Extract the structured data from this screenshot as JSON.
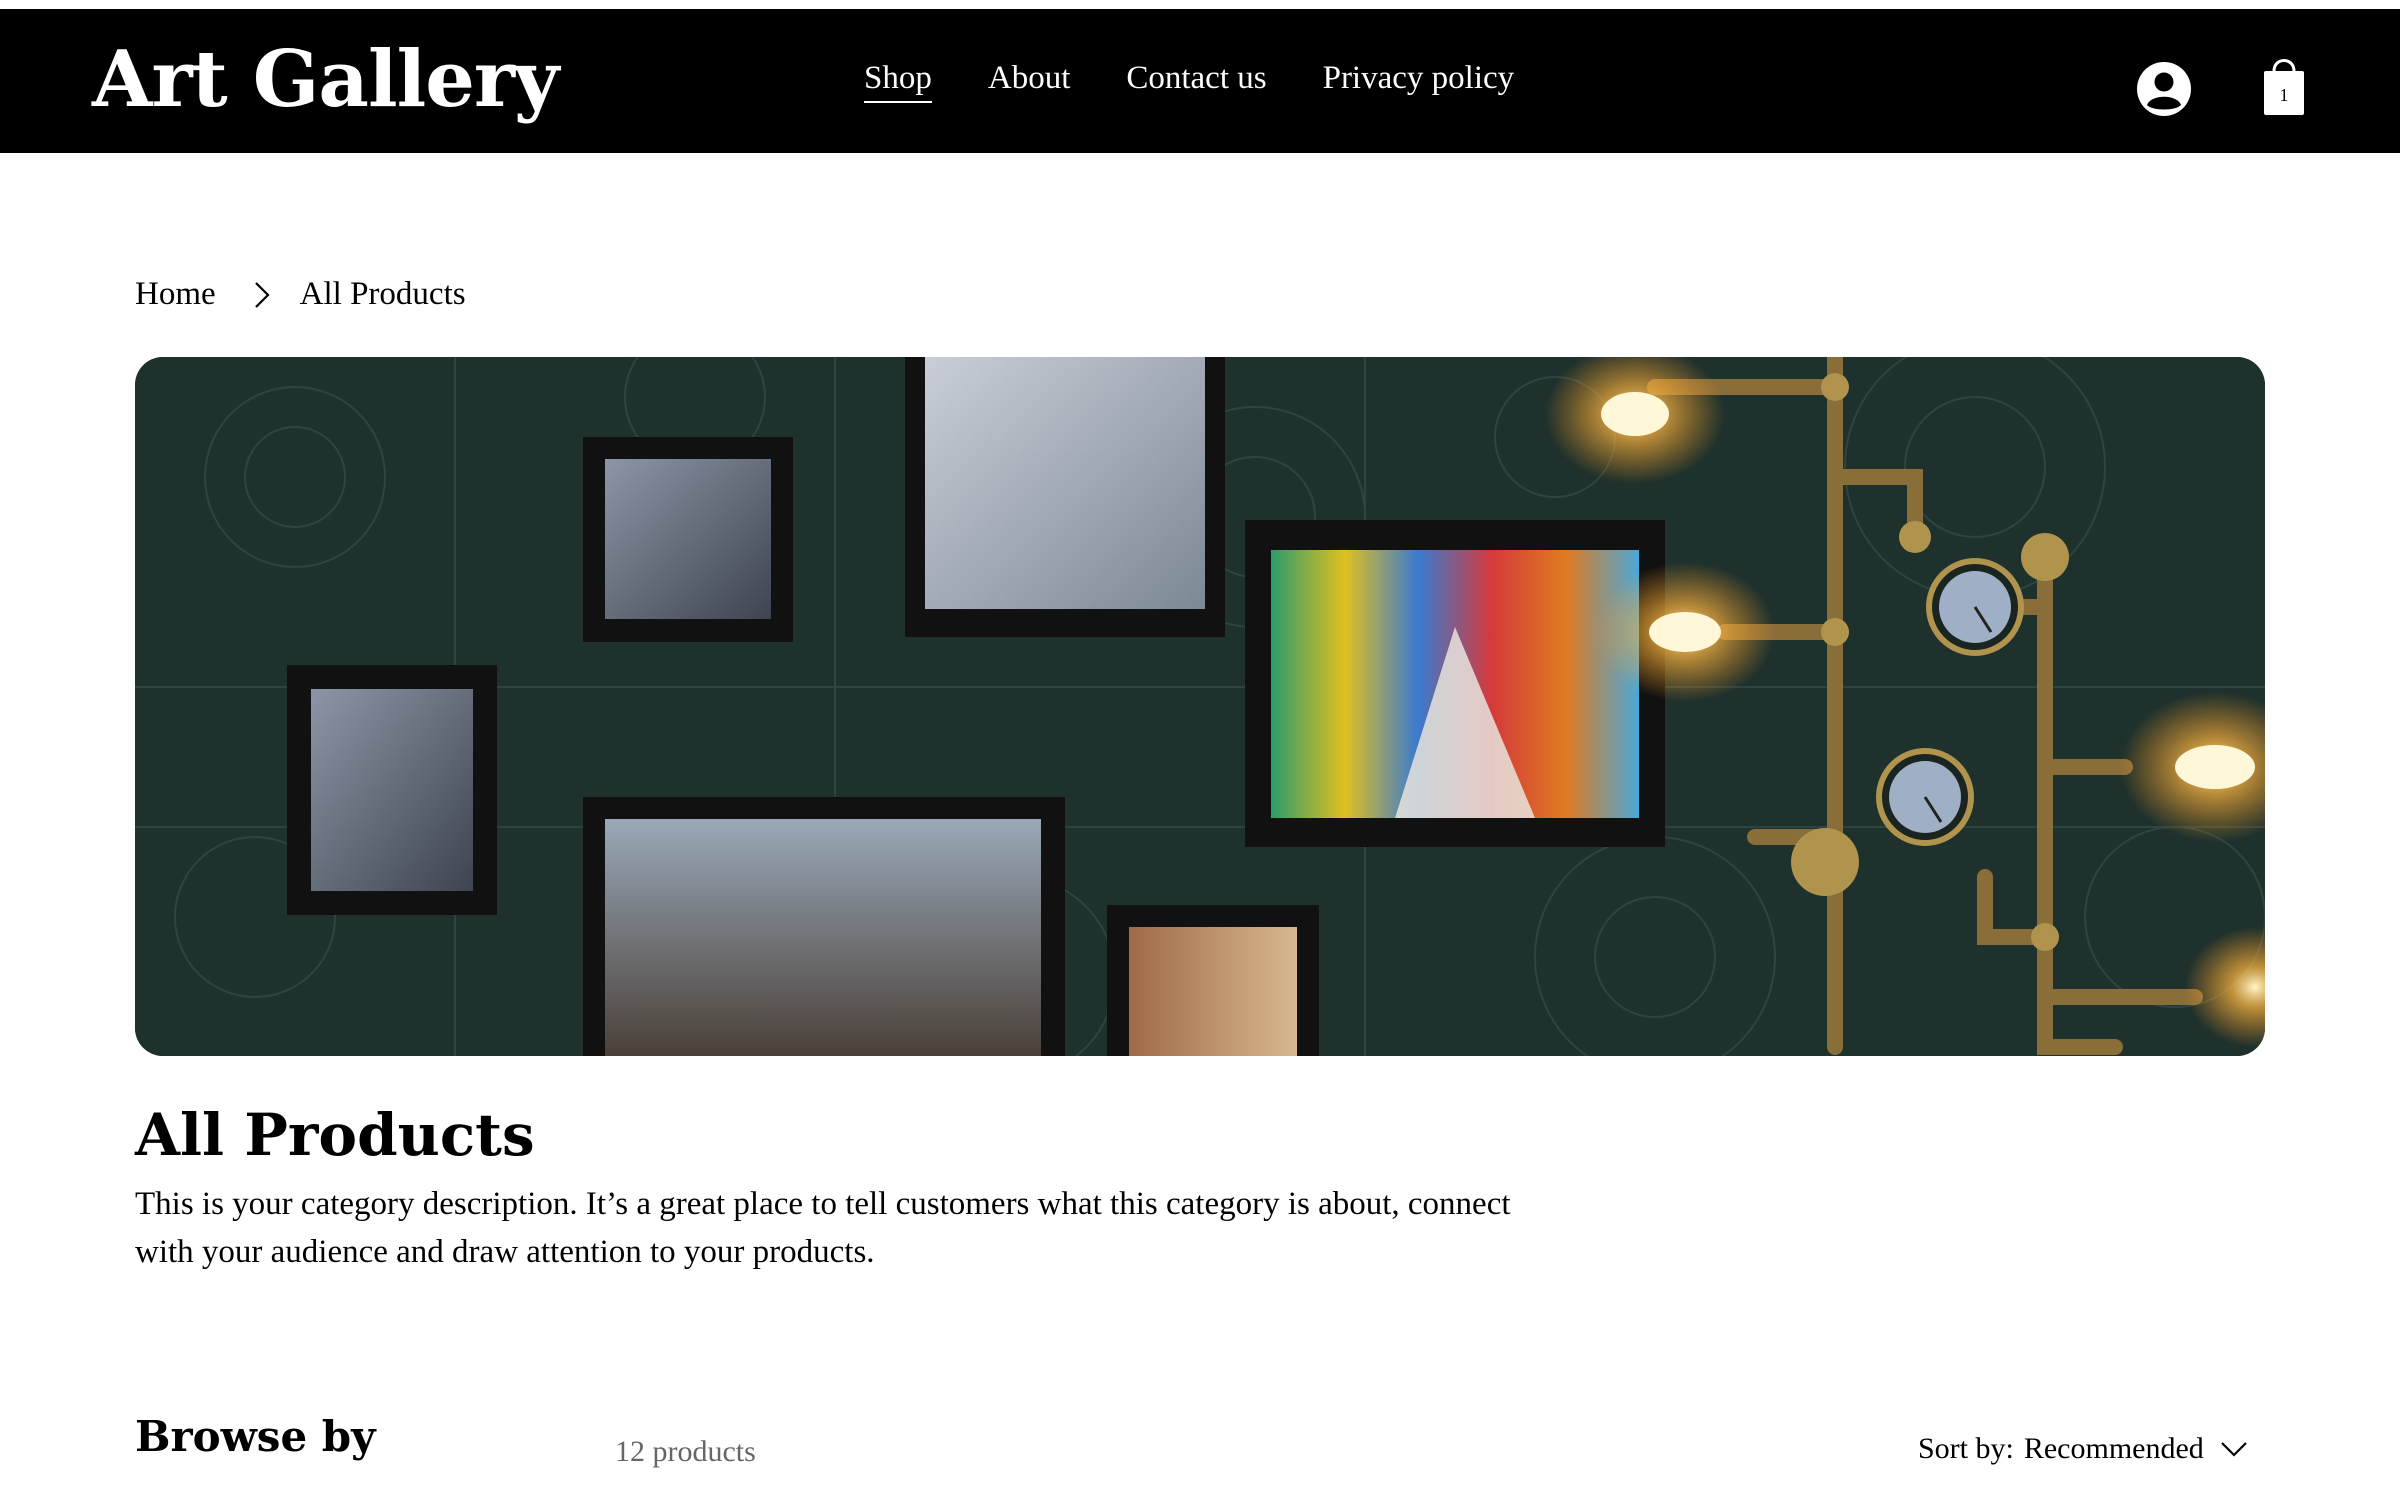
{
  "header": {
    "logo": "Art Gallery",
    "nav": [
      {
        "label": "Shop",
        "active": true
      },
      {
        "label": "About"
      },
      {
        "label": "Contact us"
      },
      {
        "label": "Privacy policy"
      }
    ],
    "user_icon": "user-circle-icon",
    "cart_icon": "shopping-bag-icon",
    "cart_count": "1"
  },
  "breadcrumb": {
    "home": "Home",
    "separator_icon": "chevron-right-icon",
    "current": "All Products"
  },
  "hero": {
    "description": "dark green blueprint wallpaper with framed architecture photos and steampunk pipe lamps"
  },
  "category": {
    "title": "All Products",
    "description": "This is your category description. It’s a great place to tell customers what this category is about, connect with your audience and draw attention to your products."
  },
  "toolbar": {
    "browse_label": "Browse by",
    "product_count": "12 products",
    "sort_label": "Sort by:",
    "sort_value": "Recommended",
    "sort_icon": "chevron-down-icon"
  },
  "colors": {
    "header_bg": "#000000",
    "header_text": "#ffffff",
    "hero_bg": "#1f312d",
    "muted_text": "#666666"
  }
}
